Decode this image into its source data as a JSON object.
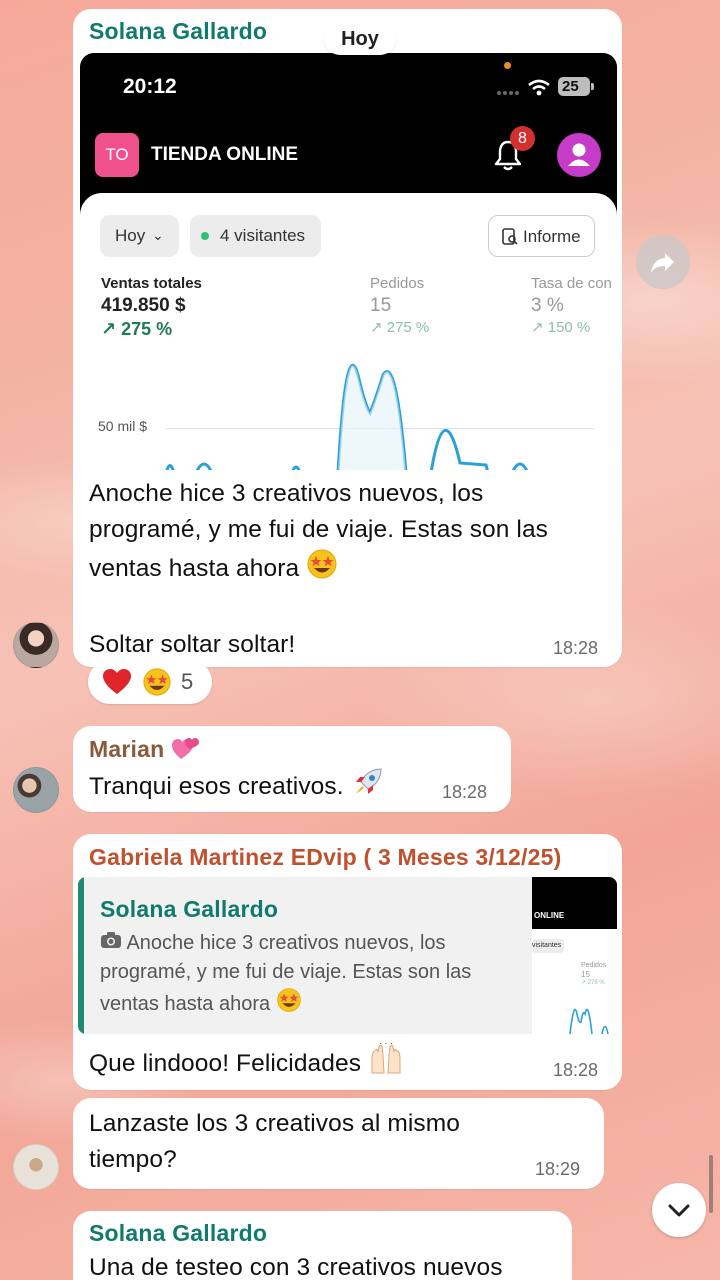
{
  "date_separator": "Hoy",
  "messages": [
    {
      "sender": "Solana Gallardo",
      "sender_color": "#0f7b6c",
      "text_lines": [
        "Anoche hice 3 creativos nuevos, los",
        "programé, y me fui de viaje. Estas son las",
        "ventas  hasta ahora"
      ],
      "text_line2": "Soltar soltar soltar!",
      "time": "18:28",
      "reactions": {
        "count": "5"
      }
    },
    {
      "sender": "Marian",
      "sender_color": "#8b5a3c",
      "text": "Tranqui esos creativos.",
      "time": "18:28"
    },
    {
      "sender": "Gabriela Martinez EDvip ( 3 Meses 3/12/25)",
      "sender_color": "#c0512f",
      "quote": {
        "sender": "Solana Gallardo",
        "lines": [
          "Anoche hice 3 creativos nuevos, los",
          "programé, y me fui de viaje. Estas son las",
          "ventas  hasta ahora"
        ],
        "thumb_brand": "ONLINE",
        "thumb_visitors": "visitantes",
        "thumb_orders_label": "Pedidos",
        "thumb_orders_value": "15",
        "thumb_orders_delta": "↗ 275 %"
      },
      "text": "Que lindooo! Felicidades",
      "time": "18:28"
    },
    {
      "text_lines": [
        "Lanzaste los 3 creativos al mismo",
        "tiempo?"
      ],
      "time": "18:29"
    },
    {
      "sender": "Solana Gallardo",
      "sender_color": "#0f7b6c",
      "text": "Una de testeo con 3 creativos nuevos"
    }
  ],
  "screenshot": {
    "status_time": "20:12",
    "battery": "25",
    "store_initials": "TO",
    "store_name": "TIENDA ONLINE",
    "notification_count": "8",
    "period_chip": "Hoy",
    "visitors_chip": "4 visitantes",
    "report_button": "Informe",
    "metrics": [
      {
        "label": "Ventas totales",
        "value": "419.850 $",
        "delta": "↗ 275 %"
      },
      {
        "label": "Pedidos",
        "value": "15",
        "delta": "↗ 275 %"
      },
      {
        "label": "Tasa de con",
        "value": "3 %",
        "delta": "↗ 150 %"
      }
    ],
    "chart_gridline_label": "50 mil $"
  },
  "colors": {
    "accent_teal": "#0f7b6c",
    "chart_line": "#2aa0d8",
    "store_badge": "#f0508c",
    "notification_badge": "#d32f2f",
    "avatar_purple": "#c63cc8"
  }
}
